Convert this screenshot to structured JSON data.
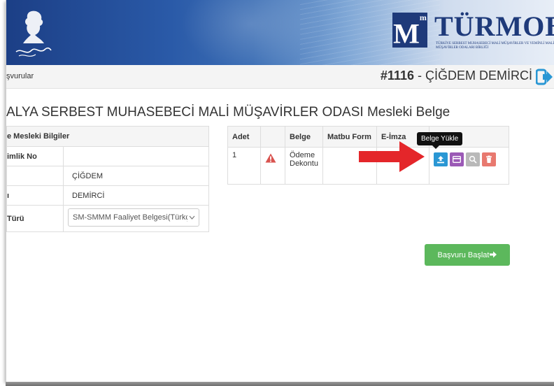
{
  "header": {
    "brand": "TÜRMOB",
    "brand_tagline": "TÜRKİYE SERBEST MUHASEBECİ MALİ MÜŞAVİRLER VE YEMİNLİ MALİ MÜŞAVİRLER ODALARI BİRLİĞİ"
  },
  "breadcrumb": {
    "text": "şvurular"
  },
  "application": {
    "id": "#1116",
    "separator": " - ",
    "applicant": "ÇİĞDEM DEMİRCİ"
  },
  "page_title": "ALYA SERBEST MUHASEBECİ MALİ MÜŞAVİRLER ODASI Mesleki Belge",
  "info_panel": {
    "heading": "e Mesleki Bilgiler",
    "rows": [
      {
        "label": "imlik No",
        "value": ""
      },
      {
        "label": "",
        "value": "ÇİĞDEM"
      },
      {
        "label": "ı",
        "value": "DEMİRCİ"
      },
      {
        "label": "Türü",
        "select_value": "SM-SMMM Faaliyet Belgesi(Türkç"
      }
    ]
  },
  "documents": {
    "columns": [
      "Adet",
      "",
      "Belge",
      "Matbu Form",
      "E-İmza",
      ""
    ],
    "rows": [
      {
        "adet": "1",
        "status_icon": "warning-icon",
        "belge": "Ödeme Dekontu",
        "matbu_form": "",
        "e_imza": ""
      }
    ]
  },
  "tooltip": "Belge Yükle",
  "start_button": {
    "label": "Başvuru Başlat",
    "icon": "arrow-right-icon"
  },
  "colors": {
    "upload": "#2a97d4",
    "card": "#9b59b6",
    "search": "#b9b9b9",
    "delete": "#e8796f",
    "start": "#5cb85c",
    "warning": "#d9534f",
    "exit": "#2a97d4",
    "arrow": "#e4262a",
    "brand": "#1e3a7a"
  }
}
